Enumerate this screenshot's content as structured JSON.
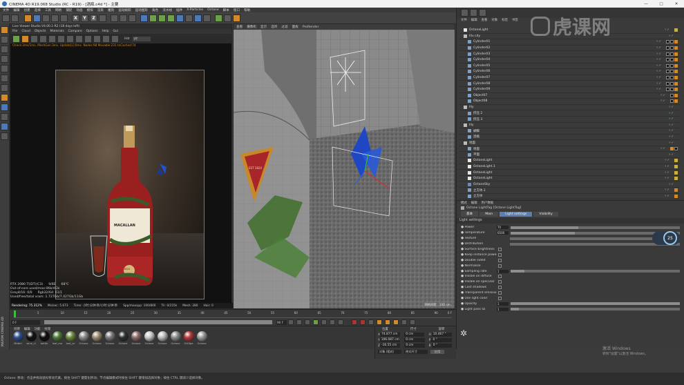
{
  "window": {
    "title": "CINEMA 4D R19.068 Studio (RC - R19) - [酒瓶.c4d *] - 主要",
    "controls": [
      "—",
      "□",
      "✕"
    ]
  },
  "main_menu": [
    "文件",
    "编辑",
    "创建",
    "选择",
    "工具",
    "网格",
    "捕捉",
    "动画",
    "模拟",
    "渲染",
    "雕刻",
    "运动跟踪",
    "运动图形",
    "角色",
    "流水线",
    "插件",
    "X-Particles",
    "Octane",
    "脚本",
    "窗口",
    "帮助"
  ],
  "main_toolbar": {
    "axis_x": "X",
    "axis_y": "Y",
    "axis_z": "Z"
  },
  "live_viewer": {
    "title": "Live Viewer Studio V4.00.1-R2 (18 days left)",
    "menu": [
      "File",
      "Cloud",
      "Objects",
      "Materials",
      "Compare",
      "Options",
      "Help",
      "Gui"
    ],
    "status_line": "Check:3ms/1ms. MeshGen:3ms. Update[L]:0ms. Nodes:98 Movable:231 txCached:74",
    "hdr_label": "Hdr",
    "render_label": "PT",
    "info": {
      "gpu": "RTX 2080 TI(DT)(C3)",
      "gpu_usage": "9/8E",
      "gpu_temp": "68℃",
      "out_of_core": "Out-of-core used/max:0Kb/4Gb",
      "grey": "Grey8/16: 0/0",
      "rgb": "Rgb32/64: 61/1",
      "vram": "Used/free/total vram: 1.727Gb/7.427Gb/11Gb",
      "rendering": "Rendering: 75.312%",
      "ms_sec": "Ms/sec: 5.673",
      "time": "Time: 小时:分钟:秒/小时:分钟:秒",
      "spp": "Spp/maxspp: 100/800",
      "tri": "Tri: 0/155k",
      "mesh": "Mesh: 280",
      "hair": "Hair: 0"
    },
    "bottle_label": "MACALLAN",
    "bottle_year": "1824"
  },
  "viewport": {
    "menu": [
      "查看",
      "摄像机",
      "显示",
      "选项",
      "过滤",
      "面板",
      "ProRender"
    ],
    "grid_label": "网格间距 : 100 cm",
    "label_year": "EST 1824"
  },
  "object_manager": {
    "tabs": [
      "文件",
      "编辑",
      "查看",
      "对象",
      "标签",
      "书签"
    ],
    "items": [
      {
        "name": "OctaneLight",
        "indent": 0,
        "icon": "light",
        "tags": "y"
      },
      {
        "name": "Illu cdy",
        "indent": 0,
        "icon": "null",
        "tags": ""
      },
      {
        "name": "Cylinder01",
        "indent": 1,
        "icon": "obj",
        "tags": "kko"
      },
      {
        "name": "Cylinder02",
        "indent": 1,
        "icon": "obj",
        "tags": "kko"
      },
      {
        "name": "Cylinder03",
        "indent": 1,
        "icon": "obj",
        "tags": "kko"
      },
      {
        "name": "Cylinder04",
        "indent": 1,
        "icon": "obj",
        "tags": "kko"
      },
      {
        "name": "Cylinder05",
        "indent": 1,
        "icon": "obj",
        "tags": "kko"
      },
      {
        "name": "Cylinder06",
        "indent": 1,
        "icon": "obj",
        "tags": "kko"
      },
      {
        "name": "Cylinder07",
        "indent": 1,
        "icon": "obj",
        "tags": "kko"
      },
      {
        "name": "Cylinder08",
        "indent": 1,
        "icon": "obj",
        "tags": "kko"
      },
      {
        "name": "Cylinder09",
        "indent": 1,
        "icon": "obj",
        "tags": "kko"
      },
      {
        "name": "Object07",
        "indent": 1,
        "icon": "obj",
        "tags": "ko"
      },
      {
        "name": "Object08",
        "indent": 1,
        "icon": "obj",
        "tags": "ko"
      },
      {
        "name": "Illy",
        "indent": 0,
        "icon": "null",
        "tags": ""
      },
      {
        "name": "挤压 2",
        "indent": 1,
        "icon": "obj",
        "tags": ""
      },
      {
        "name": "挤压 3",
        "indent": 1,
        "icon": "obj",
        "tags": ""
      },
      {
        "name": "Illy",
        "indent": 0,
        "icon": "null",
        "tags": ""
      },
      {
        "name": "蝴蝶",
        "indent": 1,
        "icon": "obj",
        "tags": ""
      },
      {
        "name": "酒瓶",
        "indent": 1,
        "icon": "obj",
        "tags": ""
      },
      {
        "name": "地面",
        "indent": 0,
        "icon": "null",
        "tags": ""
      },
      {
        "name": "地面",
        "indent": 1,
        "icon": "obj",
        "tags": "ok"
      },
      {
        "name": "平面",
        "indent": 1,
        "icon": "obj",
        "tags": ""
      },
      {
        "name": "OctaneLight",
        "indent": 1,
        "icon": "light",
        "tags": "y"
      },
      {
        "name": "OctaneLight.1",
        "indent": 1,
        "icon": "light",
        "tags": "y"
      },
      {
        "name": "OctaneLight",
        "indent": 1,
        "icon": "light",
        "tags": "y"
      },
      {
        "name": "OctaneLight",
        "indent": 1,
        "icon": "light",
        "tags": "y"
      },
      {
        "name": "OctaneSky",
        "indent": 1,
        "icon": "sky",
        "tags": ""
      },
      {
        "name": "立方体.1",
        "indent": 1,
        "icon": "obj",
        "tags": "o"
      },
      {
        "name": "立方体",
        "indent": 1,
        "icon": "obj",
        "tags": "o"
      },
      {
        "name": "OctaneSky",
        "indent": 1,
        "icon": "sky",
        "tags": ""
      },
      {
        "name": "摄像机",
        "indent": 1,
        "icon": "cam",
        "tags": "o"
      },
      {
        "name": "OctaneCamera",
        "indent": 1,
        "icon": "cam",
        "tags": ""
      }
    ]
  },
  "attributes": {
    "menu": [
      "模式",
      "编辑",
      "用户数据"
    ],
    "title": "Octane LightTag [Octane LightTag]",
    "tabs": [
      "基本",
      "Main",
      "Light settings",
      "Visibility"
    ],
    "active_tab": "Light settings",
    "section": "Light settings",
    "rows": [
      {
        "label": "Power",
        "value": "70",
        "type": "slider",
        "fill": 0.4
      },
      {
        "label": "Temperature",
        "value": "6500",
        "type": "slider",
        "fill": 0.38
      },
      {
        "label": "Texture",
        "value": "",
        "type": "bar",
        "fill": 0
      },
      {
        "label": "Distribution",
        "value": "",
        "type": "bar",
        "fill": 0
      },
      {
        "label": "Surface brightness",
        "value": "",
        "type": "check"
      },
      {
        "label": "Keep instance power",
        "value": "",
        "type": "check"
      },
      {
        "label": "Double sided",
        "value": "",
        "type": "check"
      },
      {
        "label": "Normalize",
        "value": "",
        "type": "check"
      },
      {
        "label": "Sampling rate",
        "value": "1",
        "type": "slider",
        "fill": 0.08
      },
      {
        "label": "Visible on diffuse",
        "value": "",
        "type": "check"
      },
      {
        "label": "Visible on specular",
        "value": "",
        "type": "check"
      },
      {
        "label": "Cast shadows",
        "value": "",
        "type": "check"
      },
      {
        "label": "Transparent emission",
        "value": "",
        "type": "check"
      },
      {
        "label": "Use light color",
        "value": "",
        "type": "check"
      },
      {
        "label": "Opacity",
        "value": "1",
        "type": "slider",
        "fill": 1
      },
      {
        "label": "Light pass ID",
        "value": "1",
        "type": "slider",
        "fill": 0.05
      }
    ],
    "fps": "25"
  },
  "timeline": {
    "ticks": [
      "0",
      "5",
      "10",
      "15",
      "20",
      "25",
      "30",
      "35",
      "40",
      "45",
      "50",
      "55",
      "60",
      "65",
      "70",
      "75",
      "80",
      "85",
      "90"
    ],
    "current_frame": "0 F",
    "start_frame": "0 F",
    "end_frame": "90 F",
    "end_frame_b": "90 F",
    "frame_marker": "0 F"
  },
  "material_manager": {
    "menu": [
      "创建",
      "编辑",
      "功能",
      "纹理"
    ],
    "materials": [
      {
        "name": "Materi",
        "color": "#2f4f8f"
      },
      {
        "name": "wine_cl",
        "color": "#111111"
      },
      {
        "name": "bottle",
        "color": "#0d0d0d"
      },
      {
        "name": "leaf_ma",
        "color": "#4e7a3a"
      },
      {
        "name": "leaf_ye",
        "color": "#6b8a3f"
      },
      {
        "name": "Octane",
        "color": "#8a8a8a"
      },
      {
        "name": "Octane",
        "color": "#9b8e70"
      },
      {
        "name": "Octane",
        "color": "#7a7a7a"
      },
      {
        "name": "Octane",
        "color": "#303030"
      },
      {
        "name": "Octane",
        "color": "#8c6a6a"
      },
      {
        "name": "Octane",
        "color": "#c8c8c8"
      },
      {
        "name": "Octane",
        "color": "#bbbbbb"
      },
      {
        "name": "Octane",
        "color": "#8a8a8a"
      },
      {
        "name": "OctSpe",
        "color": "#b73a3a"
      },
      {
        "name": "Octane",
        "color": "#9a9a9a"
      }
    ]
  },
  "coordinates": {
    "headers": [
      "位置",
      "尺寸",
      "旋转"
    ],
    "rows": [
      {
        "axis": "X",
        "pos": "74.877 cm",
        "size": "0 cm",
        "rot_label": "H",
        "rot": "10.467 °"
      },
      {
        "axis": "Y",
        "pos": "106.087 cm",
        "size": "0 cm",
        "rot_label": "P",
        "rot": "0 °"
      },
      {
        "axis": "Z",
        "pos": "-16.55 cm",
        "size": "0 cm",
        "rot_label": "B",
        "rot": "0 °"
      }
    ],
    "mode_dropdown": "对象 (相对)",
    "size_dropdown": "绝对尺寸",
    "apply_button": "应用"
  },
  "status_bar": "Octane: 移动：点击并拖动鼠标移动元素。按住 SHIFT 键量化移动；节点编辑模式时按住 SHIFT 键增加选择对象；按住 CTRL 键减少选择对象。",
  "watermark": {
    "brand": "虎课网",
    "activate_title": "激活 Windows",
    "activate_sub": "转到\"设置\"以激活 Windows。"
  },
  "side_logo": "MAXON CINEMA 4D"
}
